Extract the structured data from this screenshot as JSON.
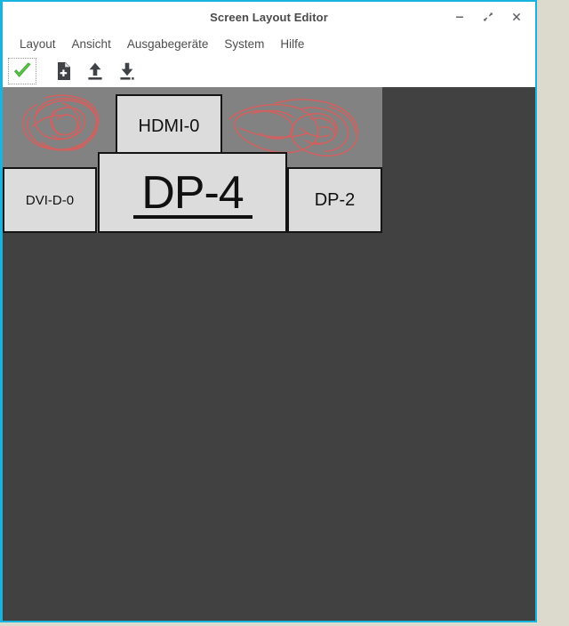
{
  "window": {
    "title": "Screen Layout Editor",
    "border_color": "#18b4e0",
    "controls": [
      {
        "name": "minimize",
        "glyph": "minimize-icon"
      },
      {
        "name": "maximize",
        "glyph": "maximize-icon"
      },
      {
        "name": "close",
        "glyph": "close-icon"
      }
    ]
  },
  "desktop": {
    "background_color": "#dcd9cd"
  },
  "menubar": {
    "items": [
      {
        "label": "Layout"
      },
      {
        "label": "Ansicht"
      },
      {
        "label": "Ausgabegeräte"
      },
      {
        "label": "System"
      },
      {
        "label": "Hilfe"
      }
    ]
  },
  "toolbar": {
    "buttons": [
      {
        "name": "apply-checkmark",
        "icon": "checkmark-icon",
        "focused": true
      },
      {
        "name": "new-layout",
        "icon": "document-add-icon",
        "focused": false
      },
      {
        "name": "load-layout",
        "icon": "arrow-up-icon",
        "focused": false
      },
      {
        "name": "save-layout",
        "icon": "arrow-down-icon",
        "focused": false
      }
    ]
  },
  "canvas": {
    "background_color": "#414141",
    "virtual_desktop_color": "#828282",
    "annotation_color": "#d9534f",
    "monitors": [
      {
        "label": "HDMI-0",
        "active": false,
        "size": "normal"
      },
      {
        "label": "DVI-D-0",
        "active": false,
        "size": "small"
      },
      {
        "label": "DP-4",
        "active": true,
        "size": "large"
      },
      {
        "label": "DP-2",
        "active": false,
        "size": "normal"
      }
    ]
  }
}
